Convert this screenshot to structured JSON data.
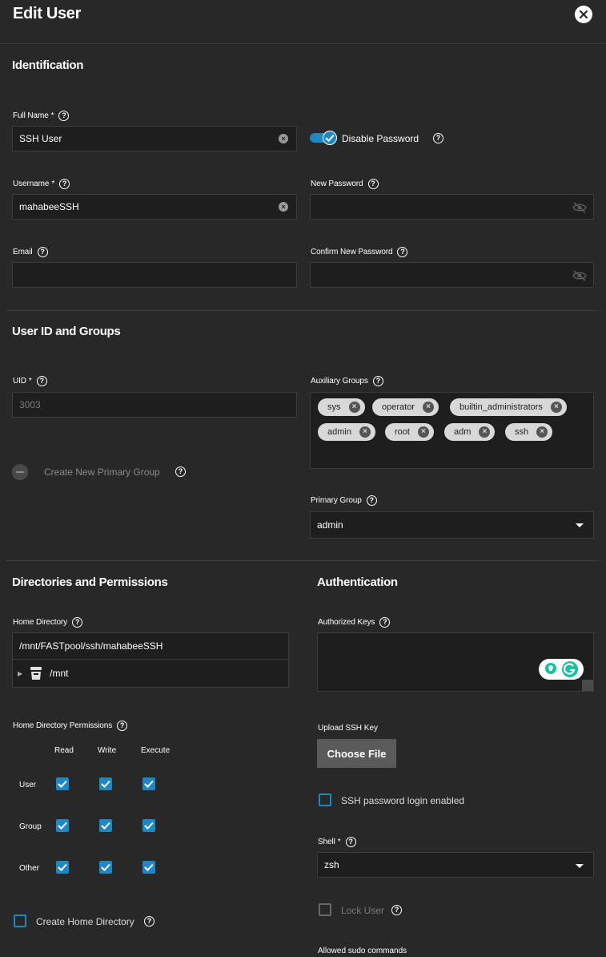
{
  "dialog": {
    "title": "Edit User"
  },
  "identification": {
    "title": "Identification",
    "full_name": {
      "label": "Full Name",
      "required": "*",
      "value": "SSH User"
    },
    "username": {
      "label": "Username",
      "required": "*",
      "value": "mahabeeSSH"
    },
    "email": {
      "label": "Email",
      "value": ""
    },
    "disable_password": {
      "label": "Disable Password",
      "checked": true
    },
    "new_password": {
      "label": "New Password",
      "value": ""
    },
    "confirm_password": {
      "label": "Confirm New Password",
      "value": ""
    }
  },
  "user_id_groups": {
    "title": "User ID and Groups",
    "uid": {
      "label": "UID",
      "required": "*",
      "value": "3003"
    },
    "create_primary_group": {
      "label": "Create New Primary Group",
      "disabled": true
    },
    "auxiliary_groups": {
      "label": "Auxiliary Groups",
      "chips": [
        "sys",
        "operator",
        "builtin_administrators",
        "admin",
        "root",
        "adm",
        "ssh"
      ]
    },
    "primary_group": {
      "label": "Primary Group",
      "value": "admin"
    }
  },
  "directories": {
    "title": "Directories and Permissions",
    "home_directory": {
      "label": "Home Directory",
      "value": "/mnt/FASTpool/ssh/mahabeeSSH",
      "tree_root": "/mnt"
    },
    "permissions": {
      "label": "Home Directory Permissions",
      "columns": [
        "Read",
        "Write",
        "Execute"
      ],
      "rows": [
        "User",
        "Group",
        "Other"
      ]
    },
    "create_home_directory": {
      "label": "Create Home Directory",
      "checked": false
    }
  },
  "authentication": {
    "title": "Authentication",
    "authorized_keys": {
      "label": "Authorized Keys",
      "value": ""
    },
    "upload_ssh_key": {
      "label": "Upload SSH Key",
      "button": "Choose File"
    },
    "ssh_password_login": {
      "label": "SSH password login enabled",
      "checked": false
    },
    "shell": {
      "label": "Shell",
      "required": "*",
      "value": "zsh"
    },
    "lock_user": {
      "label": "Lock User",
      "disabled": true
    },
    "allowed_sudo": {
      "label": "Allowed sudo commands"
    }
  },
  "colors": {
    "accent": "#1e88c5",
    "background": "#282828",
    "input_bg": "#1e1e1e"
  }
}
